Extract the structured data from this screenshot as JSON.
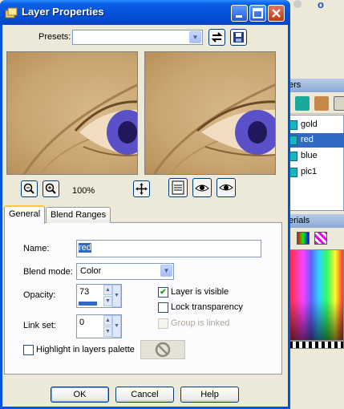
{
  "dialog": {
    "title": "Layer Properties",
    "presets_label": "Presets:",
    "presets_value": "",
    "zoom_level": "100%",
    "tabs": [
      {
        "label": "General",
        "active": true
      },
      {
        "label": "Blend Ranges",
        "active": false
      }
    ],
    "name_label": "Name:",
    "name_value": "red",
    "blend_mode_label": "Blend mode:",
    "blend_mode_value": "Color",
    "opacity_label": "Opacity:",
    "opacity_value": "73",
    "opacity_fraction": 0.73,
    "link_set_label": "Link set:",
    "link_set_value": "0",
    "layer_visible_label": "Layer is visible",
    "layer_visible_checked": true,
    "lock_transparency_label": "Lock transparency",
    "lock_transparency_checked": false,
    "group_linked_label": "Group is linked",
    "group_linked_enabled": false,
    "highlight_label": "Highlight in layers palette",
    "highlight_checked": false,
    "ok_label": "OK",
    "cancel_label": "Cancel",
    "help_label": "Help"
  },
  "layers_palette": {
    "header_fragment": "ers",
    "items": [
      {
        "name": "gold",
        "selected": false
      },
      {
        "name": "red",
        "selected": true
      },
      {
        "name": "blue",
        "selected": false
      },
      {
        "name": "pic1",
        "selected": false
      }
    ]
  },
  "materials_palette": {
    "header_fragment": "erials"
  },
  "colors": {
    "titlebar_blue": "#0054e3",
    "selection_blue": "#316ac5",
    "layer_thumb": "#16b6be"
  }
}
